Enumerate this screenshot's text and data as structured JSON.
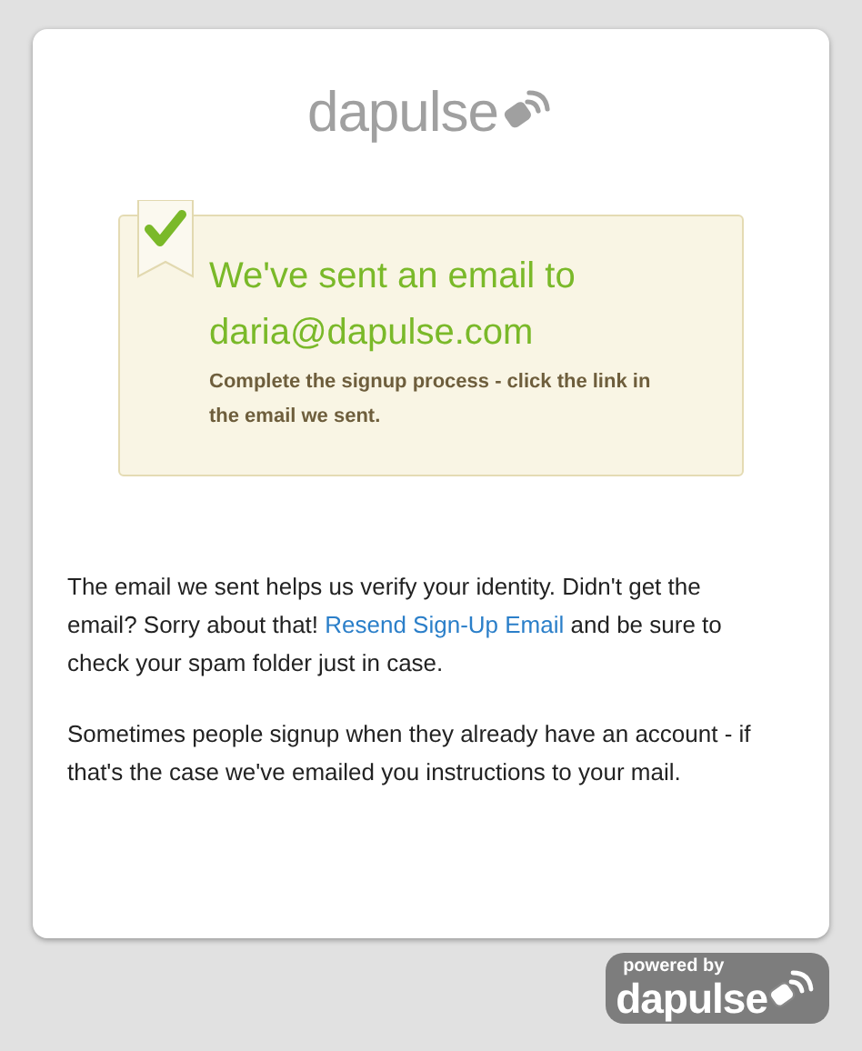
{
  "logo": {
    "text": "dapulse"
  },
  "notice": {
    "title": "We've sent an email to",
    "email": "daria@dapulse.com",
    "subtitle": "Complete the signup process - click the link in the email we sent.",
    "checked": true
  },
  "paragraphs": [
    {
      "before": "The email we sent helps us verify your identity. Didn't get the email? Sorry about that! ",
      "link": "Resend Sign-Up Email",
      "after": " and be sure to check your spam folder just in case."
    },
    {
      "before": "Sometimes people signup when they already have an account - if that's the case we've emailed you instructions to your mail."
    }
  ],
  "powered_by": {
    "caption": "powered by",
    "brand": "dapulse"
  }
}
